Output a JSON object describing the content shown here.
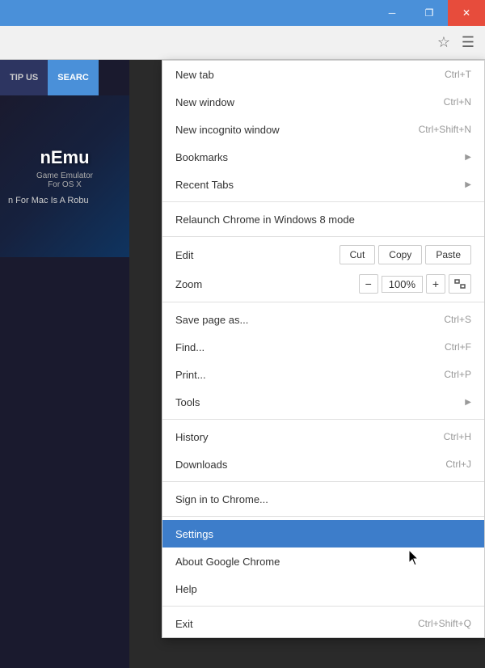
{
  "titleBar": {
    "minimizeLabel": "─",
    "restoreLabel": "❐",
    "closeLabel": "✕"
  },
  "addressBar": {
    "starIcon": "☆",
    "menuIcon": "☰"
  },
  "pageContent": {
    "navItems": [
      {
        "label": "TIP US",
        "active": false
      },
      {
        "label": "SEARC",
        "active": true
      }
    ],
    "imageTitle": "nEmu",
    "imageSubtitle": "Game Emulator\nFor OS X",
    "imageDesc": "n For Mac Is A Robu"
  },
  "dropdownMenu": {
    "items": [
      {
        "type": "item",
        "label": "New tab",
        "shortcut": "Ctrl+T"
      },
      {
        "type": "item",
        "label": "New window",
        "shortcut": "Ctrl+N"
      },
      {
        "type": "item",
        "label": "New incognito window",
        "shortcut": "Ctrl+Shift+N"
      },
      {
        "type": "item",
        "label": "Bookmarks",
        "arrow": true
      },
      {
        "type": "item",
        "label": "Recent Tabs",
        "arrow": true
      },
      {
        "type": "divider"
      },
      {
        "type": "item",
        "label": "Relaunch Chrome in Windows 8 mode",
        "shortcut": ""
      },
      {
        "type": "divider"
      },
      {
        "type": "edit",
        "label": "Edit",
        "cut": "Cut",
        "copy": "Copy",
        "paste": "Paste"
      },
      {
        "type": "zoom",
        "label": "Zoom",
        "minus": "−",
        "value": "100%",
        "plus": "+"
      },
      {
        "type": "divider"
      },
      {
        "type": "item",
        "label": "Save page as...",
        "shortcut": "Ctrl+S"
      },
      {
        "type": "item",
        "label": "Find...",
        "shortcut": "Ctrl+F"
      },
      {
        "type": "item",
        "label": "Print...",
        "shortcut": "Ctrl+P"
      },
      {
        "type": "item",
        "label": "Tools",
        "arrow": true
      },
      {
        "type": "divider"
      },
      {
        "type": "item",
        "label": "History",
        "shortcut": "Ctrl+H"
      },
      {
        "type": "item",
        "label": "Downloads",
        "shortcut": "Ctrl+J"
      },
      {
        "type": "divider"
      },
      {
        "type": "item",
        "label": "Sign in to Chrome...",
        "shortcut": ""
      },
      {
        "type": "divider"
      },
      {
        "type": "item",
        "label": "Settings",
        "shortcut": "",
        "highlighted": true
      },
      {
        "type": "item",
        "label": "About Google Chrome",
        "shortcut": ""
      },
      {
        "type": "item",
        "label": "Help",
        "shortcut": ""
      },
      {
        "type": "divider"
      },
      {
        "type": "item",
        "label": "Exit",
        "shortcut": "Ctrl+Shift+Q"
      }
    ]
  }
}
